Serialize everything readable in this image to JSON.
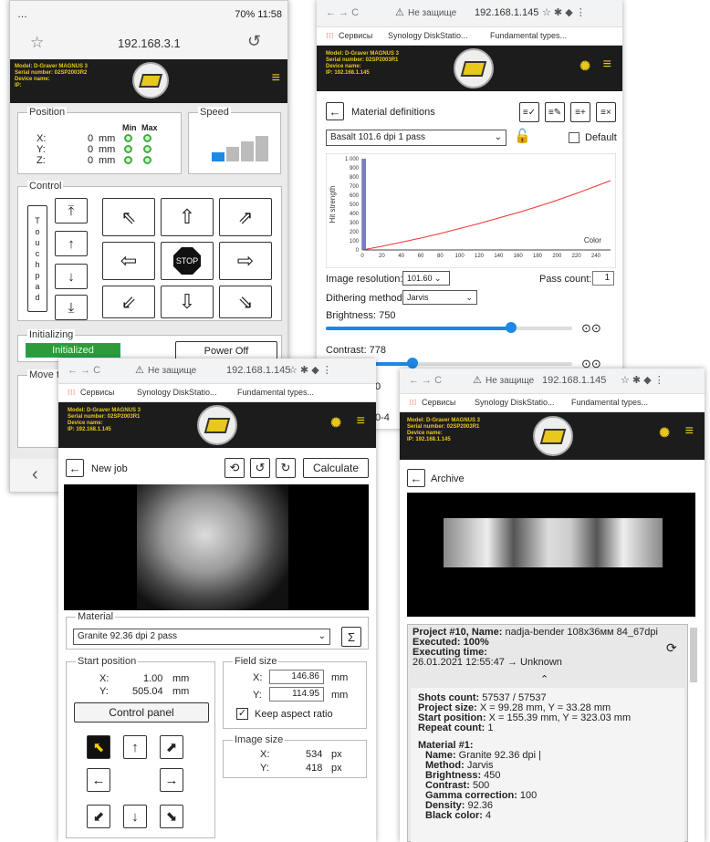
{
  "phone": {
    "status_left": "…",
    "status_right": "70% 11:58",
    "url": "192.168.3.1",
    "model": "Model: D-Graver MAGNUS 3",
    "serial": "Serial number: 02SP2003R2",
    "device": "Device name:",
    "ip": "IP:",
    "position_label": "Position",
    "speed_label": "Speed",
    "min": "Min",
    "max": "Max",
    "axes": [
      {
        "name": "X:",
        "val": "0",
        "unit": "mm"
      },
      {
        "name": "Y:",
        "val": "0",
        "unit": "mm"
      },
      {
        "name": "Z:",
        "val": "0",
        "unit": "mm"
      }
    ],
    "control_label": "Control",
    "touchpad": [
      "T",
      "o",
      "u",
      "c",
      "h",
      "p",
      "a",
      "d"
    ],
    "stop": "STOP",
    "initializing_label": "Initializing",
    "initialized": "Initialized",
    "power_off": "Power Off",
    "move_label": "Move t"
  },
  "browser": {
    "not_secure": "Не защище",
    "url": "192.168.1.145",
    "bookmarks": [
      "Сервисы",
      "Synology DiskStatio...",
      "Fundamental types..."
    ],
    "model": "Model: D-Graver MAGNUS 3",
    "serial": "Serial number: 02SP2003R1",
    "device": "Device name:",
    "ip": "IP: 192.168.1.145"
  },
  "material": {
    "not_secure": "Не защище",
    "title": "Material definitions",
    "material": "Basalt 101.6 dpi 1 pass",
    "default_label": "Default",
    "resolution_label": "Image resolution:",
    "resolution": "101.60",
    "pass_label": "Pass count:",
    "pass": "1",
    "dither_label": "Dithering method:",
    "dither": "Jarvis",
    "brightness": "Brightness: 750",
    "contrast": "Contrast: 778",
    "cut_a": "0",
    "cut_b": "0-4",
    "brightness_frac": 0.75,
    "contrast_frac": 0.35
  },
  "chart_data": {
    "type": "line",
    "ylabel": "Hit strength",
    "xlabel": "Color",
    "x": [
      0,
      20,
      40,
      60,
      80,
      100,
      120,
      140,
      160,
      180,
      200,
      220,
      240,
      255
    ],
    "y": [
      0,
      40,
      85,
      130,
      180,
      235,
      290,
      350,
      410,
      475,
      545,
      620,
      700,
      760
    ],
    "ylim": [
      0,
      1000
    ],
    "xlim": [
      0,
      255
    ],
    "yticks": [
      "1 000",
      "900",
      "800",
      "700",
      "600",
      "500",
      "400",
      "300",
      "200",
      "100",
      "0"
    ],
    "xticks": [
      "0",
      "20",
      "40",
      "60",
      "80",
      "100",
      "120",
      "140",
      "160",
      "180",
      "200",
      "220",
      "240"
    ]
  },
  "newjob": {
    "title": "New job",
    "calculate": "Calculate",
    "material_label": "Material",
    "material": "Granite 92.36 dpi 2 pass",
    "start_label": "Start position",
    "sx": "1.00",
    "sy": "505.04",
    "unit": "mm",
    "x": "X:",
    "y": "Y:",
    "control_panel": "Control panel",
    "field_label": "Field size",
    "fx": "146.86",
    "fy": "114.95",
    "keep": "Keep aspect ratio",
    "image_size_label": "Image size",
    "ix": "534",
    "iy": "418",
    "px": "px"
  },
  "archive": {
    "title": "Archive",
    "proj": "Project #10,",
    "name_label": "Name:",
    "name": "nadja-bender 108x36мм 84_67dpi",
    "executed": "Executed: 100%",
    "exec_time": "Executing time:",
    "time": "26.01.2021 12:55:47 → Unknown",
    "details": [
      [
        "Shots count:",
        "57537 / 57537"
      ],
      [
        "Project size:",
        "X = 99.28 mm, Y = 33.28 mm"
      ],
      [
        "Start position:",
        "X = 155.39 mm, Y = 323.03 mm"
      ],
      [
        "Repeat count:",
        "1"
      ]
    ],
    "mat_header": "Material #1:",
    "mat": [
      [
        "Name:",
        "Granite 92.36 dpi |"
      ],
      [
        "Method:",
        "Jarvis"
      ],
      [
        "Brightness:",
        "450"
      ],
      [
        "Contrast:",
        "500"
      ],
      [
        "Gamma correction:",
        "100"
      ],
      [
        "Density:",
        "92.36"
      ],
      [
        "Black color:",
        "4"
      ]
    ]
  }
}
